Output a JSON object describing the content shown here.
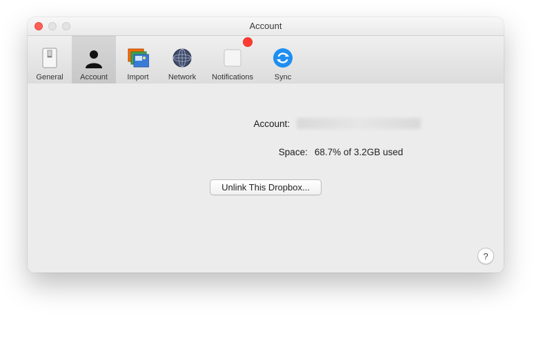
{
  "window": {
    "title": "Account"
  },
  "toolbar": {
    "items": [
      {
        "label": "General"
      },
      {
        "label": "Account"
      },
      {
        "label": "Import"
      },
      {
        "label": "Network"
      },
      {
        "label": "Notifications"
      },
      {
        "label": "Sync"
      }
    ]
  },
  "account": {
    "label": "Account:",
    "value_redacted": true
  },
  "space": {
    "label": "Space:",
    "value": "68.7% of 3.2GB used"
  },
  "unlink_button": "Unlink This Dropbox...",
  "help_button": "?"
}
